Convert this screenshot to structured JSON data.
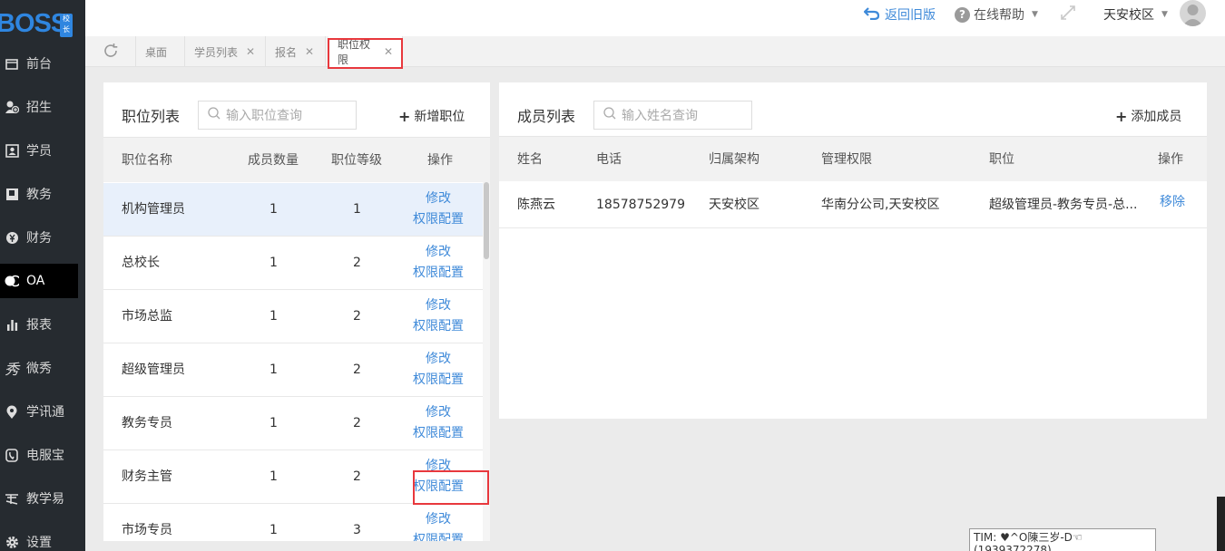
{
  "sidebar": {
    "logo_text": "BOSS",
    "logo_badge": "校长",
    "items": [
      {
        "label": "前台",
        "icon": "desk-icon"
      },
      {
        "label": "招生",
        "icon": "user-plus-icon"
      },
      {
        "label": "学员",
        "icon": "id-card-icon"
      },
      {
        "label": "教务",
        "icon": "book-icon"
      },
      {
        "label": "财务",
        "icon": "yen-icon"
      },
      {
        "label": "OA",
        "icon": "oa-icon",
        "active": true
      },
      {
        "label": "报表",
        "icon": "bar-chart-icon"
      },
      {
        "label": "微秀",
        "icon": "xiu-icon"
      },
      {
        "label": "学讯通",
        "icon": "location-icon"
      },
      {
        "label": "电服宝",
        "icon": "phone-icon"
      },
      {
        "label": "教学易",
        "icon": "teach-icon"
      },
      {
        "label": "设置",
        "icon": "gear-icon"
      }
    ]
  },
  "topbar": {
    "back_label": "返回旧版",
    "help_label": "在线帮助",
    "campus_label": "天安校区"
  },
  "tabs": [
    {
      "label": "桌面",
      "closable": false
    },
    {
      "label": "学员列表",
      "closable": true
    },
    {
      "label": "报名",
      "closable": true
    },
    {
      "label": "职位权限",
      "closable": true,
      "active": true
    }
  ],
  "positions_panel": {
    "title": "职位列表",
    "search_placeholder": "输入职位查询",
    "add_label": "新增职位",
    "columns": [
      "职位名称",
      "成员数量",
      "职位等级",
      "操作"
    ],
    "edit_label": "修改",
    "perm_label": "权限配置",
    "rows": [
      {
        "name": "机构管理员",
        "count": "1",
        "level": "1"
      },
      {
        "name": "总校长",
        "count": "1",
        "level": "2"
      },
      {
        "name": "市场总监",
        "count": "1",
        "level": "2"
      },
      {
        "name": "超级管理员",
        "count": "1",
        "level": "2"
      },
      {
        "name": "教务专员",
        "count": "1",
        "level": "2"
      },
      {
        "name": "财务主管",
        "count": "1",
        "level": "2"
      },
      {
        "name": "市场专员",
        "count": "1",
        "level": "3"
      }
    ]
  },
  "members_panel": {
    "title": "成员列表",
    "search_placeholder": "输入姓名查询",
    "add_label": "添加成员",
    "columns": [
      "姓名",
      "电话",
      "归属架构",
      "管理权限",
      "职位",
      "操作"
    ],
    "rows": [
      {
        "name": "陈燕云",
        "phone": "18578752979",
        "org": "天安校区",
        "scope": "华南分公司,天安校区",
        "position": "超级管理员-教务专员-总...",
        "action": "移除"
      }
    ]
  },
  "tooltip": {
    "line1": "TIM: ♥^O陳三岁-D☜(1939372278)",
    "line2": "……"
  },
  "colors": {
    "accent": "#3f8ad9",
    "highlight": "#e8383d",
    "sidebar_bg": "#262b30"
  }
}
